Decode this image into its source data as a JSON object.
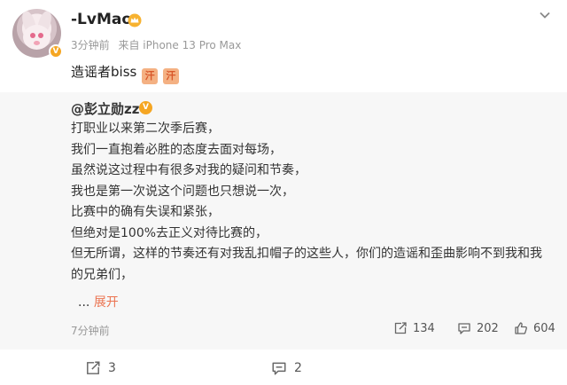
{
  "post": {
    "username": "-LvMao",
    "meta": {
      "time": "3分钟前",
      "source": "来自 iPhone 13 Pro Max"
    },
    "text": "造谣者biss",
    "emoji": [
      "汗",
      "汗"
    ],
    "verified_badge": "V"
  },
  "repost": {
    "author": "@彭立勋zz",
    "verified_badge": "V",
    "lines": [
      "打职业以来第二次季后赛，",
      "我们一直抱着必胜的态度去面对每场，",
      "虽然说这过程中有很多对我的疑问和节奏，",
      "我也是第一次说这个问题也只想说一次，",
      "比赛中的确有失误和紧张，",
      "但绝对是100%去正义对待比赛的，",
      "但无所谓，这样的节奏还有对我乱扣帽子的这些人，你们的造谣和歪曲影响不到我和我",
      "的兄弟们，"
    ],
    "expand_prefix": "...",
    "expand_label": "展开",
    "time": "7分钟前",
    "stats": {
      "reposts": "134",
      "comments": "202",
      "likes": "604"
    }
  },
  "footer": {
    "reposts": "3",
    "comments": "2"
  },
  "colors": {
    "accent": "#eb7350",
    "badge": "#f5a623",
    "repost_bg": "#f7f7f7",
    "muted": "#999999"
  },
  "icons": [
    "crown-icon",
    "chevron-down-icon",
    "repost-icon",
    "comment-icon",
    "like-icon"
  ]
}
